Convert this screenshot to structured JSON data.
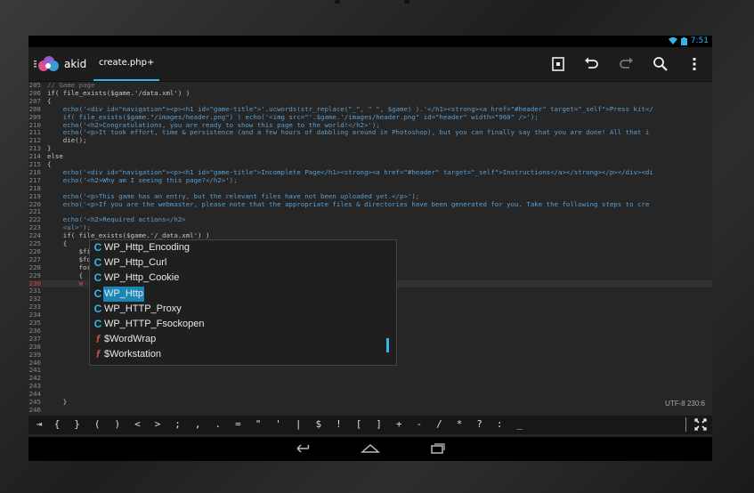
{
  "status": {
    "time": "7:51"
  },
  "actionbar": {
    "app_name": "akid",
    "tab_label": "create.php+"
  },
  "editor": {
    "lines": [
      {
        "num": "205",
        "text": "// Game page"
      },
      {
        "num": "206",
        "text": "if( file_exists($game.'/data.xml') )"
      },
      {
        "num": "207",
        "text": "{"
      },
      {
        "num": "208",
        "text": "    echo('<div id=\"navigation\"><p><h1 id=\"game-title\">'.ucwords(str_replace(\"_\", \" \", $game) ).'</h1><strong><a href=\"#header\" target=\"_self\">Press kit</"
      },
      {
        "num": "209",
        "text": "    if( file_exists($game.\"/images/header.png\") ) echo('<img src=\"'.$game.'/images/header.png\" id=\"header\" width=\"960\" />');"
      },
      {
        "num": "210",
        "text": "    echo('<h2>Congratulations, you are ready to show this page to the world!</h2>');"
      },
      {
        "num": "211",
        "text": "    echo('<p>It took effort, time & persistence (and a few hours of dabbling around in Photoshop), but you can finally say that you are done! All that i"
      },
      {
        "num": "212",
        "text": "    die();"
      },
      {
        "num": "213",
        "text": "}"
      },
      {
        "num": "214",
        "text": "else"
      },
      {
        "num": "215",
        "text": "{"
      },
      {
        "num": "216",
        "text": "    echo('<div id=\"navigation\"><p><h1 id=\"game-title\">Incomplete Page</h1><strong><a href=\"#header\" target=\"_self\">Instructions</a></strong></p></div><di"
      },
      {
        "num": "217",
        "text": "    echo('<h2>Why am I seeing this page?</h2>');"
      },
      {
        "num": "218",
        "text": ""
      },
      {
        "num": "219",
        "text": "    echo('<p>This game has an entry, but the relevant files have not been uploaded yet.</p>');"
      },
      {
        "num": "220",
        "text": "    echo('<p>If you are the webmaster, please note that the appropriate files & directories have been generated for you. Take the following steps to cre"
      },
      {
        "num": "221",
        "text": ""
      },
      {
        "num": "222",
        "text": "    echo('<h2>Required actions</h2>"
      },
      {
        "num": "223",
        "text": "    <ul>');"
      },
      {
        "num": "224",
        "text": "    if( file_exists($game.'/_data.xml') )"
      },
      {
        "num": "225",
        "text": "    {"
      },
      {
        "num": "226",
        "text": "        $file = file($game.'/_data.xml', FILE_SKIP_EMPTY_LINES);"
      },
      {
        "num": "227",
        "text": "        $found = 0;"
      },
      {
        "num": "228",
        "text": "        foreach( $file as $line_num => $line )"
      },
      {
        "num": "229",
        "text": "        {"
      },
      {
        "num": "230",
        "text": "        W"
      },
      {
        "num": "231",
        "text": ""
      },
      {
        "num": "232",
        "text": ""
      },
      {
        "num": "233",
        "text": ""
      },
      {
        "num": "234",
        "text": ""
      },
      {
        "num": "235",
        "text": ""
      },
      {
        "num": "236",
        "text": "                                                                $game) ) );"
      },
      {
        "num": "237",
        "text": ""
      },
      {
        "num": "238",
        "text": "                                                                   \" \", $game) ) )"
      },
      {
        "num": "239",
        "text": ""
      },
      {
        "num": "240",
        "text": ""
      },
      {
        "num": "241",
        "text": ""
      },
      {
        "num": "242",
        "text": ""
      },
      {
        "num": "243",
        "text": ""
      },
      {
        "num": "244",
        "text": ""
      },
      {
        "num": "245",
        "text": "    }"
      },
      {
        "num": "246",
        "text": ""
      },
      {
        "num": "247",
        "text": ""
      }
    ],
    "encoding": "UTF-8 230:6"
  },
  "autocomplete": {
    "items": [
      {
        "kind": "C",
        "label": "WP_Http_Encoding"
      },
      {
        "kind": "C",
        "label": "WP_Http_Curl"
      },
      {
        "kind": "C",
        "label": "WP_Http_Cookie"
      },
      {
        "kind": "C",
        "label": "WP_Http"
      },
      {
        "kind": "C",
        "label": "WP_HTTP_Proxy"
      },
      {
        "kind": "C",
        "label": "WP_HTTP_Fsockopen"
      },
      {
        "kind": "f",
        "label": "$WordWrap"
      },
      {
        "kind": "f",
        "label": "$Workstation"
      }
    ]
  },
  "symbols": [
    "{",
    "}",
    "(",
    ")",
    "<",
    ">",
    ";",
    ",",
    ".",
    "=",
    "\"",
    "'",
    "|",
    "$",
    "!",
    "[",
    "]",
    "+",
    "-",
    "/",
    "*",
    "?",
    ":",
    "_"
  ],
  "colors": {
    "accent": "#33b5e5",
    "selection": "#1a86b6",
    "function_icon": "#d04a4a"
  }
}
